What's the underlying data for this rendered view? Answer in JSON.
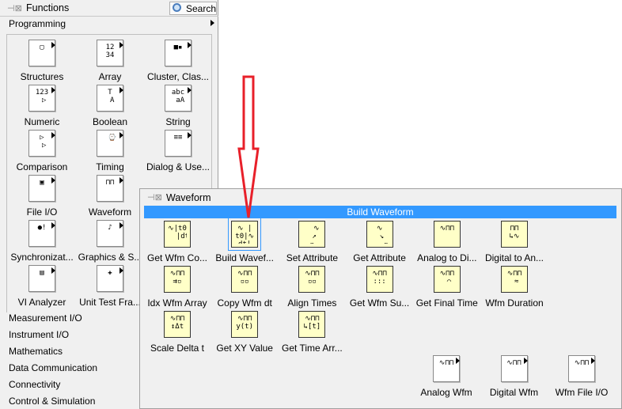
{
  "functions": {
    "title": "Functions",
    "search_label": "Search",
    "subpalette": "Programming",
    "items": [
      {
        "label": "Structures",
        "icon": "structures-icon",
        "g": "▢"
      },
      {
        "label": "Array",
        "icon": "array-icon",
        "g": "12\n34"
      },
      {
        "label": "Cluster, Clas...",
        "icon": "cluster-icon",
        "g": "■▪"
      },
      {
        "label": "Numeric",
        "icon": "numeric-icon",
        "g": "123\n ▷"
      },
      {
        "label": "Boolean",
        "icon": "boolean-icon",
        "g": "T\n A"
      },
      {
        "label": "String",
        "icon": "string-icon",
        "g": "abc\n aA"
      },
      {
        "label": "Comparison",
        "icon": "comparison-icon",
        "g": "▷\n ▷"
      },
      {
        "label": "Timing",
        "icon": "timing-icon",
        "g": " ⌚"
      },
      {
        "label": "Dialog & Use...",
        "icon": "dialog-icon",
        "g": "≡≡"
      },
      {
        "label": "File I/O",
        "icon": "file-io-icon",
        "g": "▣"
      },
      {
        "label": "Waveform",
        "icon": "waveform-icon",
        "g": "⊓⊓"
      },
      {
        "label": "",
        "icon": "hidden-icon",
        "g": ""
      },
      {
        "label": "Synchronizat...",
        "icon": "synchronization-icon",
        "g": "●!"
      },
      {
        "label": "Graphics & S...",
        "icon": "graphics-sound-icon",
        "g": "♪"
      },
      {
        "label": "",
        "icon": "hidden-icon",
        "g": ""
      },
      {
        "label": "VI Analyzer",
        "icon": "vi-analyzer-icon",
        "g": "▤"
      },
      {
        "label": "Unit Test Fra...",
        "icon": "unit-test-icon",
        "g": "✚"
      }
    ],
    "categories": [
      "Measurement I/O",
      "Instrument I/O",
      "Mathematics",
      "Data Communication",
      "Connectivity",
      "Control & Simulation"
    ]
  },
  "waveform": {
    "title": "Waveform",
    "selected": "Build Waveform",
    "items": [
      {
        "label": "Get Wfm Co...",
        "g": "∿|t0\n  |dt"
      },
      {
        "label": "Build Wavef...",
        "g": "∿ |\nt0|∿\ndt|"
      },
      {
        "label": "Set Attribute",
        "g": "  ∿\n ↗\n▫"
      },
      {
        "label": "Get Attribute",
        "g": "∿\n ↘\n   ▫"
      },
      {
        "label": "Analog to Di...",
        "g": "∿⊓⊓"
      },
      {
        "label": "Digital to An...",
        "g": "⊓⊓\n↳∿"
      },
      {
        "label": "Idx Wfm Array",
        "g": "∿⊓⊓\n⇉▫"
      },
      {
        "label": "Copy Wfm dt",
        "g": "∿⊓⊓\n▫▫"
      },
      {
        "label": "Align Times",
        "g": "∿⊓⊓\n▫▫"
      },
      {
        "label": "Get Wfm Su...",
        "g": "∿⊓⊓\n:::"
      },
      {
        "label": "Get Final Time",
        "g": "∿⊓⊓\n ⌒"
      },
      {
        "label": "Wfm Duration",
        "g": "∿⊓⊓\n ≈"
      },
      {
        "label": "Scale Delta t",
        "g": "∿⊓⊓\n↕Δt"
      },
      {
        "label": "Get XY Value",
        "g": "∿⊓⊓\ny(t)"
      },
      {
        "label": "Get Time Arr...",
        "g": "∿⊓⊓\n↳[t]"
      }
    ],
    "subpalettes": [
      {
        "label": "Analog Wfm",
        "icon": "analog-wfm-icon"
      },
      {
        "label": "Digital Wfm",
        "icon": "digital-wfm-icon"
      },
      {
        "label": "Wfm File I/O",
        "icon": "wfm-file-io-icon"
      }
    ]
  },
  "colors": {
    "highlight": "#3399ff",
    "arrow": "#e8202a"
  }
}
